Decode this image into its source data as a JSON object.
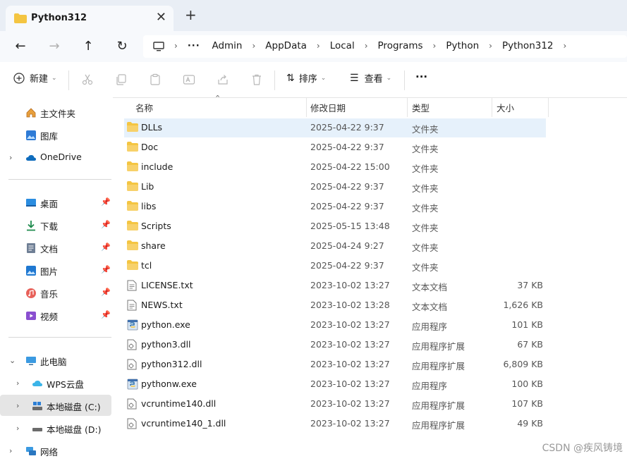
{
  "window": {
    "tab_title": "Python312",
    "close_glyph": "✕",
    "newtab_glyph": "+"
  },
  "nav": {
    "back": "←",
    "forward": "→",
    "up": "↑",
    "refresh": "↻",
    "crumbs": [
      "Admin",
      "AppData",
      "Local",
      "Programs",
      "Python",
      "Python312"
    ],
    "more": "···",
    "sep": "›"
  },
  "toolbar": {
    "new_label": "新建",
    "sort_label": "排序",
    "view_label": "查看",
    "more_label": "···"
  },
  "sidebar": {
    "items": [
      {
        "label": "主文件夹",
        "icon": "home-icon"
      },
      {
        "label": "图库",
        "icon": "gallery-icon"
      },
      {
        "label": "OneDrive",
        "icon": "cloud-icon"
      },
      {
        "label": "桌面",
        "icon": "desktop-icon"
      },
      {
        "label": "下载",
        "icon": "download-icon"
      },
      {
        "label": "文档",
        "icon": "document-icon"
      },
      {
        "label": "图片",
        "icon": "pictures-icon"
      },
      {
        "label": "音乐",
        "icon": "music-icon"
      },
      {
        "label": "视频",
        "icon": "video-icon"
      },
      {
        "label": "此电脑",
        "icon": "computer-icon"
      },
      {
        "label": "WPS云盘",
        "icon": "wps-cloud-icon"
      },
      {
        "label": "本地磁盘 (C:)",
        "icon": "drive-c-icon"
      },
      {
        "label": "本地磁盘 (D:)",
        "icon": "drive-d-icon"
      },
      {
        "label": "网络",
        "icon": "network-icon"
      }
    ]
  },
  "columns": {
    "name": "名称",
    "date": "修改日期",
    "type": "类型",
    "size": "大小"
  },
  "files": [
    {
      "name": "DLLs",
      "date": "2025-04-22 9:37",
      "type": "文件夹",
      "size": "",
      "kind": "folder"
    },
    {
      "name": "Doc",
      "date": "2025-04-22 9:37",
      "type": "文件夹",
      "size": "",
      "kind": "folder"
    },
    {
      "name": "include",
      "date": "2025-04-22 15:00",
      "type": "文件夹",
      "size": "",
      "kind": "folder"
    },
    {
      "name": "Lib",
      "date": "2025-04-22 9:37",
      "type": "文件夹",
      "size": "",
      "kind": "folder"
    },
    {
      "name": "libs",
      "date": "2025-04-22 9:37",
      "type": "文件夹",
      "size": "",
      "kind": "folder"
    },
    {
      "name": "Scripts",
      "date": "2025-05-15 13:48",
      "type": "文件夹",
      "size": "",
      "kind": "folder"
    },
    {
      "name": "share",
      "date": "2025-04-24 9:27",
      "type": "文件夹",
      "size": "",
      "kind": "folder"
    },
    {
      "name": "tcl",
      "date": "2025-04-22 9:37",
      "type": "文件夹",
      "size": "",
      "kind": "folder"
    },
    {
      "name": "LICENSE.txt",
      "date": "2023-10-02 13:27",
      "type": "文本文档",
      "size": "37 KB",
      "kind": "text"
    },
    {
      "name": "NEWS.txt",
      "date": "2023-10-02 13:28",
      "type": "文本文档",
      "size": "1,626 KB",
      "kind": "text"
    },
    {
      "name": "python.exe",
      "date": "2023-10-02 13:27",
      "type": "应用程序",
      "size": "101 KB",
      "kind": "exe"
    },
    {
      "name": "python3.dll",
      "date": "2023-10-02 13:27",
      "type": "应用程序扩展",
      "size": "67 KB",
      "kind": "dll"
    },
    {
      "name": "python312.dll",
      "date": "2023-10-02 13:27",
      "type": "应用程序扩展",
      "size": "6,809 KB",
      "kind": "dll"
    },
    {
      "name": "pythonw.exe",
      "date": "2023-10-02 13:27",
      "type": "应用程序",
      "size": "100 KB",
      "kind": "exe"
    },
    {
      "name": "vcruntime140.dll",
      "date": "2023-10-02 13:27",
      "type": "应用程序扩展",
      "size": "107 KB",
      "kind": "dll"
    },
    {
      "name": "vcruntime140_1.dll",
      "date": "2023-10-02 13:27",
      "type": "应用程序扩展",
      "size": "49 KB",
      "kind": "dll"
    }
  ],
  "watermark": "CSDN @疾风铸境",
  "colors": {
    "accent": "#0067c0",
    "folder": "#f4c542",
    "selected_row": "#e6f1fb"
  }
}
